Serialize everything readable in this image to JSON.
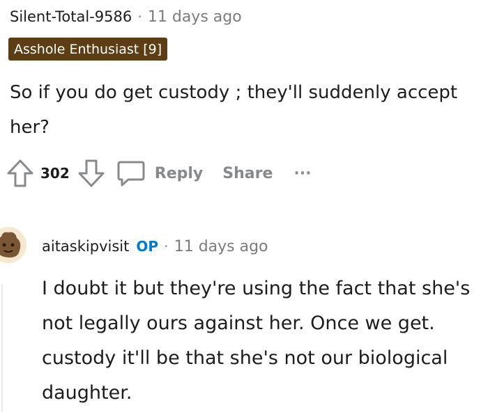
{
  "comment1": {
    "username": "Silent-Total-9586",
    "separator": "·",
    "time": "11 days ago",
    "flair": "Asshole Enthusiast [9]",
    "body": "So if you do get custody ; they'll suddenly accept her?",
    "score": "302",
    "actions": {
      "reply": "Reply",
      "share": "Share",
      "more": "···"
    },
    "icons": [
      "upvote-icon",
      "downvote-icon",
      "comment-icon",
      "more-icon"
    ]
  },
  "comment2": {
    "username": "aitaskipvisit",
    "op_badge": "OP",
    "separator": "·",
    "time": "11 days ago",
    "body": "I doubt it but they're using the fact that she's not legally ours against her. Once we get. custody it'll be that she's not our biological daughter."
  },
  "colors": {
    "flair_bg": "#5c3d14",
    "op_blue": "#0079d3",
    "muted": "#878a8c"
  }
}
